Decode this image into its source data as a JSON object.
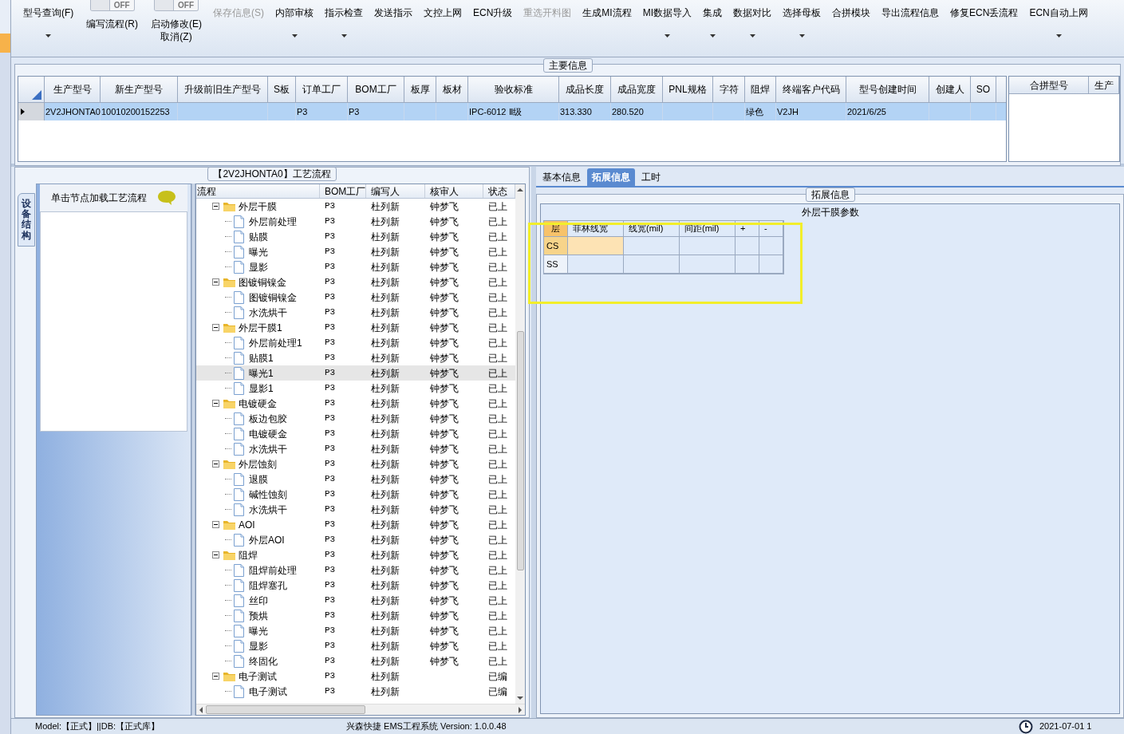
{
  "toolbar": [
    {
      "kind": "button",
      "label": "型号查询(F)",
      "dropdown": true,
      "disabled": false
    },
    {
      "kind": "toggle",
      "switch_label": "OFF",
      "on": false,
      "label": "编写流程(R)"
    },
    {
      "kind": "toggle",
      "switch_label": "OFF",
      "on": false,
      "label": "启动修改(E)",
      "label2": "取消(Z)"
    },
    {
      "kind": "button",
      "label": "保存信息(S)",
      "dropdown": false,
      "disabled": true
    },
    {
      "kind": "button",
      "label": "内部审核",
      "dropdown": true,
      "disabled": false
    },
    {
      "kind": "button",
      "label": "指示检查",
      "dropdown": true,
      "disabled": false
    },
    {
      "kind": "button",
      "label": "发送指示",
      "dropdown": false,
      "disabled": false
    },
    {
      "kind": "button",
      "label": "文控上网",
      "dropdown": false,
      "disabled": false
    },
    {
      "kind": "button",
      "label": "ECN升级",
      "dropdown": false,
      "disabled": false
    },
    {
      "kind": "button",
      "label": "重选开料图",
      "dropdown": false,
      "disabled": true
    },
    {
      "kind": "button",
      "label": "生成MI流程",
      "dropdown": false,
      "disabled": false
    },
    {
      "kind": "button",
      "label": "MI数据导入",
      "dropdown": true,
      "disabled": false
    },
    {
      "kind": "button",
      "label": "集成",
      "dropdown": true,
      "disabled": false
    },
    {
      "kind": "button",
      "label": "数据对比",
      "dropdown": true,
      "disabled": false
    },
    {
      "kind": "button",
      "label": "选择母板",
      "dropdown": true,
      "disabled": false
    },
    {
      "kind": "button",
      "label": "合拼模块",
      "dropdown": false,
      "disabled": false
    },
    {
      "kind": "button",
      "label": "导出流程信息",
      "dropdown": false,
      "disabled": false
    },
    {
      "kind": "button",
      "label": "修复ECN丢流程",
      "dropdown": false,
      "disabled": false
    },
    {
      "kind": "button",
      "label": "ECN自动上网",
      "dropdown": true,
      "disabled": false
    }
  ],
  "main_info": {
    "legend": "主要信息",
    "columns": [
      "生产型号",
      "新生产型号",
      "升级前旧生产型号",
      "S板",
      "订单工厂",
      "BOM工厂",
      "板厚",
      "板材",
      "验收标准",
      "成品长度",
      "成品宽度",
      "PNL规格",
      "字符",
      "阻焊",
      "终端客户代码",
      "型号创建时间",
      "创建人",
      "SO"
    ],
    "rows": [
      {
        "selected": true,
        "cells": [
          "2V2JHONTA0",
          "10010200152253",
          null,
          null,
          "P3",
          "P3",
          null,
          null,
          "IPC-6012 Ⅱ级",
          "313.330",
          "280.520",
          null,
          null,
          "绿色",
          "V2JH",
          "2021/6/25",
          null,
          null
        ]
      }
    ]
  },
  "merge_table": {
    "columns": [
      "合拼型号",
      "生产"
    ]
  },
  "process_panel": {
    "legend": "【2V2JHONTA0】工艺流程",
    "side_tabs": [
      {
        "label": "设备结构",
        "selected": true
      }
    ],
    "hint": "单击节点加载工艺流程",
    "columns": [
      "流程",
      "BOM工厂",
      "编写人",
      "核审人",
      "状态"
    ],
    "tree": [
      {
        "name": "外层干膜",
        "bom": "P3",
        "writer": "杜列新",
        "reviewer": "钟梦飞",
        "status": "已上",
        "selected": false,
        "expanded": true,
        "children": [
          {
            "name": "外层前处理",
            "bom": "P3",
            "writer": "杜列新",
            "reviewer": "钟梦飞",
            "status": "已上",
            "selected": false
          },
          {
            "name": "贴膜",
            "bom": "P3",
            "writer": "杜列新",
            "reviewer": "钟梦飞",
            "status": "已上",
            "selected": false
          },
          {
            "name": "曝光",
            "bom": "P3",
            "writer": "杜列新",
            "reviewer": "钟梦飞",
            "status": "已上",
            "selected": false
          },
          {
            "name": "显影",
            "bom": "P3",
            "writer": "杜列新",
            "reviewer": "钟梦飞",
            "status": "已上",
            "selected": false
          }
        ]
      },
      {
        "name": "图镀铜镍金",
        "bom": "P3",
        "writer": "杜列新",
        "reviewer": "钟梦飞",
        "status": "已上",
        "selected": false,
        "expanded": true,
        "children": [
          {
            "name": "图镀铜镍金",
            "bom": "P3",
            "writer": "杜列新",
            "reviewer": "钟梦飞",
            "status": "已上",
            "selected": false
          },
          {
            "name": "水洗烘干",
            "bom": "P3",
            "writer": "杜列新",
            "reviewer": "钟梦飞",
            "status": "已上",
            "selected": false
          }
        ]
      },
      {
        "name": "外层干膜1",
        "bom": "P3",
        "writer": "杜列新",
        "reviewer": "钟梦飞",
        "status": "已上",
        "selected": false,
        "expanded": true,
        "children": [
          {
            "name": "外层前处理1",
            "bom": "P3",
            "writer": "杜列新",
            "reviewer": "钟梦飞",
            "status": "已上",
            "selected": false
          },
          {
            "name": "贴膜1",
            "bom": "P3",
            "writer": "杜列新",
            "reviewer": "钟梦飞",
            "status": "已上",
            "selected": false
          },
          {
            "name": "曝光1",
            "bom": "P3",
            "writer": "杜列新",
            "reviewer": "钟梦飞",
            "status": "已上",
            "selected": true
          },
          {
            "name": "显影1",
            "bom": "P3",
            "writer": "杜列新",
            "reviewer": "钟梦飞",
            "status": "已上",
            "selected": false
          }
        ]
      },
      {
        "name": "电镀硬金",
        "bom": "P3",
        "writer": "杜列新",
        "reviewer": "钟梦飞",
        "status": "已上",
        "selected": false,
        "expanded": true,
        "children": [
          {
            "name": "板边包胶",
            "bom": "P3",
            "writer": "杜列新",
            "reviewer": "钟梦飞",
            "status": "已上",
            "selected": false
          },
          {
            "name": "电镀硬金",
            "bom": "P3",
            "writer": "杜列新",
            "reviewer": "钟梦飞",
            "status": "已上",
            "selected": false
          },
          {
            "name": "水洗烘干",
            "bom": "P3",
            "writer": "杜列新",
            "reviewer": "钟梦飞",
            "status": "已上",
            "selected": false
          }
        ]
      },
      {
        "name": "外层蚀刻",
        "bom": "P3",
        "writer": "杜列新",
        "reviewer": "钟梦飞",
        "status": "已上",
        "selected": false,
        "expanded": true,
        "children": [
          {
            "name": "退膜",
            "bom": "P3",
            "writer": "杜列新",
            "reviewer": "钟梦飞",
            "status": "已上",
            "selected": false
          },
          {
            "name": "碱性蚀刻",
            "bom": "P3",
            "writer": "杜列新",
            "reviewer": "钟梦飞",
            "status": "已上",
            "selected": false
          },
          {
            "name": "水洗烘干",
            "bom": "P3",
            "writer": "杜列新",
            "reviewer": "钟梦飞",
            "status": "已上",
            "selected": false
          }
        ]
      },
      {
        "name": "AOI",
        "bom": "P3",
        "writer": "杜列新",
        "reviewer": "钟梦飞",
        "status": "已上",
        "selected": false,
        "expanded": true,
        "children": [
          {
            "name": "外层AOI",
            "bom": "P3",
            "writer": "杜列新",
            "reviewer": "钟梦飞",
            "status": "已上",
            "selected": false
          }
        ]
      },
      {
        "name": "阻焊",
        "bom": "P3",
        "writer": "杜列新",
        "reviewer": "钟梦飞",
        "status": "已上",
        "selected": false,
        "expanded": true,
        "children": [
          {
            "name": "阻焊前处理",
            "bom": "P3",
            "writer": "杜列新",
            "reviewer": "钟梦飞",
            "status": "已上",
            "selected": false
          },
          {
            "name": "阻焊塞孔",
            "bom": "P3",
            "writer": "杜列新",
            "reviewer": "钟梦飞",
            "status": "已上",
            "selected": false
          },
          {
            "name": "丝印",
            "bom": "P3",
            "writer": "杜列新",
            "reviewer": "钟梦飞",
            "status": "已上",
            "selected": false
          },
          {
            "name": "预烘",
            "bom": "P3",
            "writer": "杜列新",
            "reviewer": "钟梦飞",
            "status": "已上",
            "selected": false
          },
          {
            "name": "曝光",
            "bom": "P3",
            "writer": "杜列新",
            "reviewer": "钟梦飞",
            "status": "已上",
            "selected": false
          },
          {
            "name": "显影",
            "bom": "P3",
            "writer": "杜列新",
            "reviewer": "钟梦飞",
            "status": "已上",
            "selected": false
          },
          {
            "name": "终固化",
            "bom": "P3",
            "writer": "杜列新",
            "reviewer": "钟梦飞",
            "status": "已上",
            "selected": false
          }
        ]
      },
      {
        "name": "电子测试",
        "bom": "P3",
        "writer": "杜列新",
        "status": "已编",
        "selected": false,
        "expanded": true,
        "children": [
          {
            "name": "电子测试",
            "bom": "P3",
            "writer": "杜列新",
            "status": "已编",
            "selected": false
          }
        ]
      }
    ]
  },
  "detail_panel": {
    "tabs": [
      {
        "label": "基本信息",
        "selected": false
      },
      {
        "label": "拓展信息",
        "selected": true
      },
      {
        "label": "工时",
        "selected": false
      }
    ],
    "legend": "拓展信息",
    "header": "外层干膜参数",
    "columns": [
      "层",
      "菲林线宽",
      "线宽(mil)",
      "间距(mil)",
      "+",
      "-"
    ],
    "rows": [
      {
        "layer": "CS",
        "selected": true
      },
      {
        "layer": "SS",
        "selected": false
      }
    ]
  },
  "status_bar": {
    "left": "Model:【正式】||DB:【正式库】",
    "center": "兴森快捷 EMS工程系统 Version: 1.0.0.48",
    "right": "2021-07-01 1"
  }
}
